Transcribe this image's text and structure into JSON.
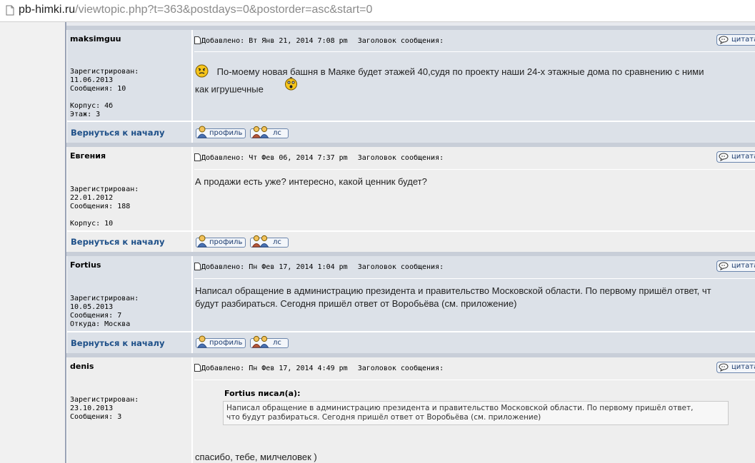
{
  "browser": {
    "url_host": "pb-himki.ru",
    "url_path": "/viewtopic.php?t=363&postdays=0&postorder=asc&start=0"
  },
  "labels": {
    "quote": "цитата",
    "profile": "профиль",
    "pm": "лс",
    "back_to_top": "Вернуться к началу",
    "subject": "Заголовок сообщения:"
  },
  "posts": [
    {
      "author": "maksimguu",
      "details": "Зарегистрирован:\n11.06.2013\nСообщения: 10\n\nКорпус: 4б\nЭтаж: 3",
      "date": "Добавлено: Вт Янв 21, 2014 7:08 pm",
      "body_line1": "По-моему новая башня в Маяке будет этажей 40,судя по проекту наши 24-х этажные дома по сравнению с ними",
      "body_line2": "как игрушечные"
    },
    {
      "author": "Евгения",
      "details": "Зарегистрирован:\n22.01.2012\nСообщения: 188\n\nКорпус: 10",
      "date": "Добавлено: Чт Фев 06, 2014 7:37 pm",
      "body": "А продажи есть уже? интересно, какой ценник будет?"
    },
    {
      "author": "Fortius",
      "details": "Зарегистрирован:\n10.05.2013\nСообщения: 7\nОткуда: Москва",
      "date": "Добавлено: Пн Фев 17, 2014 1:04 pm",
      "body_line1": "Написал обращение в администрацию президента и правительство Московской области. По первому пришёл ответ, чт",
      "body_line2": "будут разбираться. Сегодня пришёл ответ от Воробьёва (см. приложение)"
    },
    {
      "author": "denis",
      "details": "Зарегистрирован:\n23.10.2013\nСообщения: 3",
      "date": "Добавлено: Пн Фев 17, 2014 4:49 pm",
      "quote_author": "Fortius писал(а):",
      "quote_line1": "Написал обращение в администрацию президента и правительство Московской области. По первому пришёл ответ,",
      "quote_line2": "что будут разбираться. Сегодня пришёл ответ от Воробьёва (см. приложение)",
      "body": "спасибо, тебе, милчеловек )"
    }
  ]
}
